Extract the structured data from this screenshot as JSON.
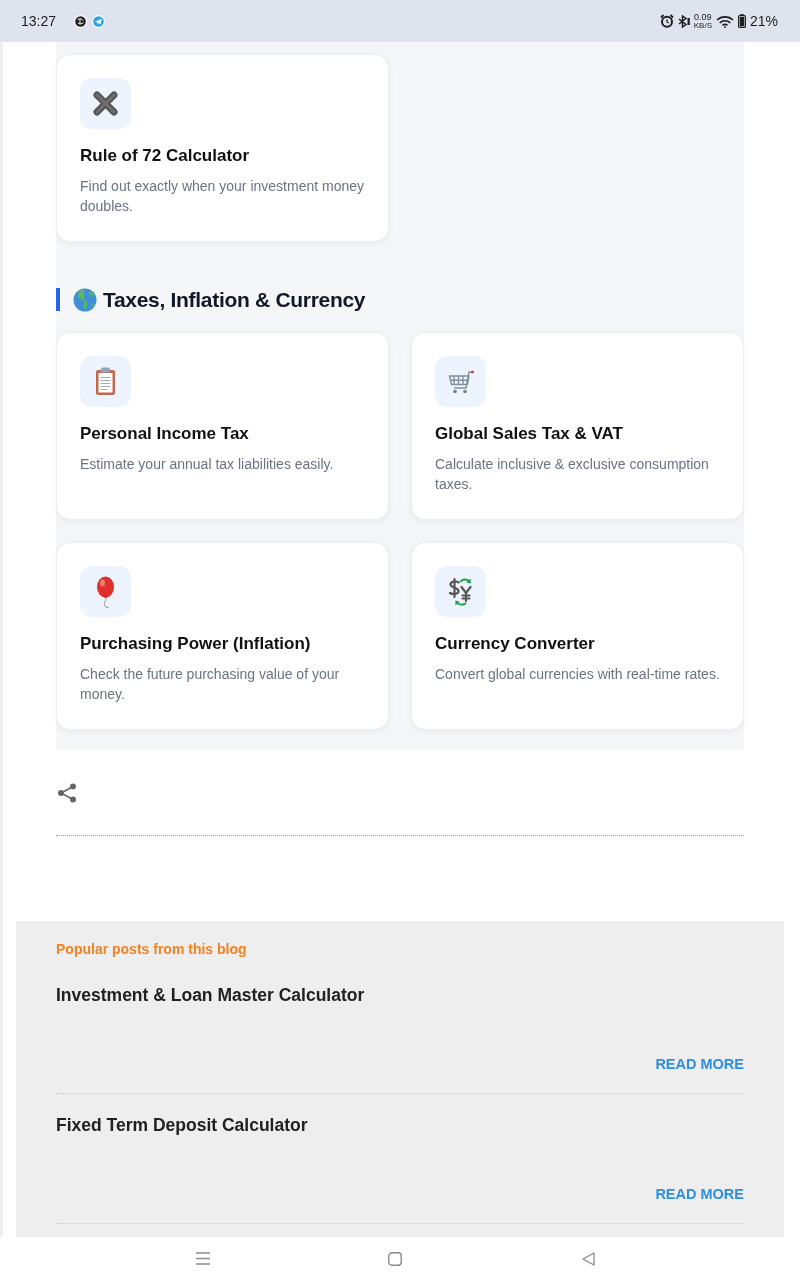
{
  "status_bar": {
    "time": "13:27",
    "net_speed": "0.09",
    "net_speed_unit": "KB/S",
    "battery": "21%"
  },
  "sections": [
    {
      "cards": [
        {
          "kind": "multiply",
          "title": "Rule of 72 Calculator",
          "description": "Find out exactly when your investment money doubles."
        }
      ]
    },
    {
      "heading": "Taxes, Inflation & Currency",
      "cards": [
        {
          "kind": "clipboard",
          "title": "Personal Income Tax",
          "description": "Estimate your annual tax liabilities easily."
        },
        {
          "kind": "cart",
          "title": "Global Sales Tax & VAT",
          "description": "Calculate inclusive & exclusive consumption taxes."
        },
        {
          "kind": "balloon",
          "title": "Purchasing Power (Inflation)",
          "description": "Check the future purchasing value of your money."
        },
        {
          "kind": "exchange",
          "title": "Currency Converter",
          "description": "Convert global currencies with real-time rates."
        }
      ]
    }
  ],
  "popular_posts": {
    "heading": "Popular posts from this blog",
    "posts": [
      {
        "title": "Investment & Loan Master Calculator",
        "link": "READ MORE"
      },
      {
        "title": "Fixed Term Deposit Calculator",
        "link": "READ MORE"
      }
    ]
  }
}
